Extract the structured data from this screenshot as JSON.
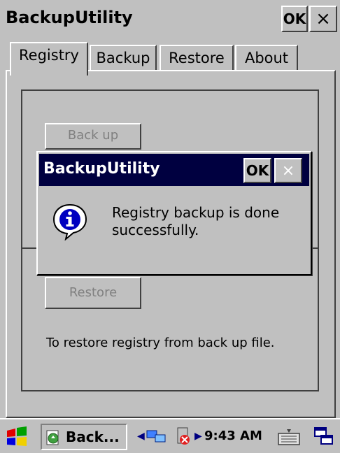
{
  "window": {
    "title": "BackupUtility",
    "ok_label": "OK",
    "close_label": "×"
  },
  "tabs": [
    {
      "label": "Registry",
      "selected": true
    },
    {
      "label": "Backup",
      "selected": false
    },
    {
      "label": "Restore",
      "selected": false
    },
    {
      "label": "About",
      "selected": false
    }
  ],
  "registry_page": {
    "backup_button": "Back up",
    "restore_button": "Restore",
    "restore_description": "To restore registry from back up file."
  },
  "dialog": {
    "title": "BackupUtility",
    "ok_label": "OK",
    "close_label": "×",
    "message": "Registry backup is done successfully.",
    "icon": "info-icon"
  },
  "taskbar": {
    "task_label": "Back...",
    "clock": "9:43 AM",
    "icons": [
      "start-icon",
      "backup-app-icon",
      "network-icon",
      "battery-icon",
      "keyboard-icon",
      "windows-icon"
    ]
  },
  "colors": {
    "face": "#c0c0c0",
    "dialog_title_bg": "#000040",
    "info_blue": "#0000c0"
  }
}
